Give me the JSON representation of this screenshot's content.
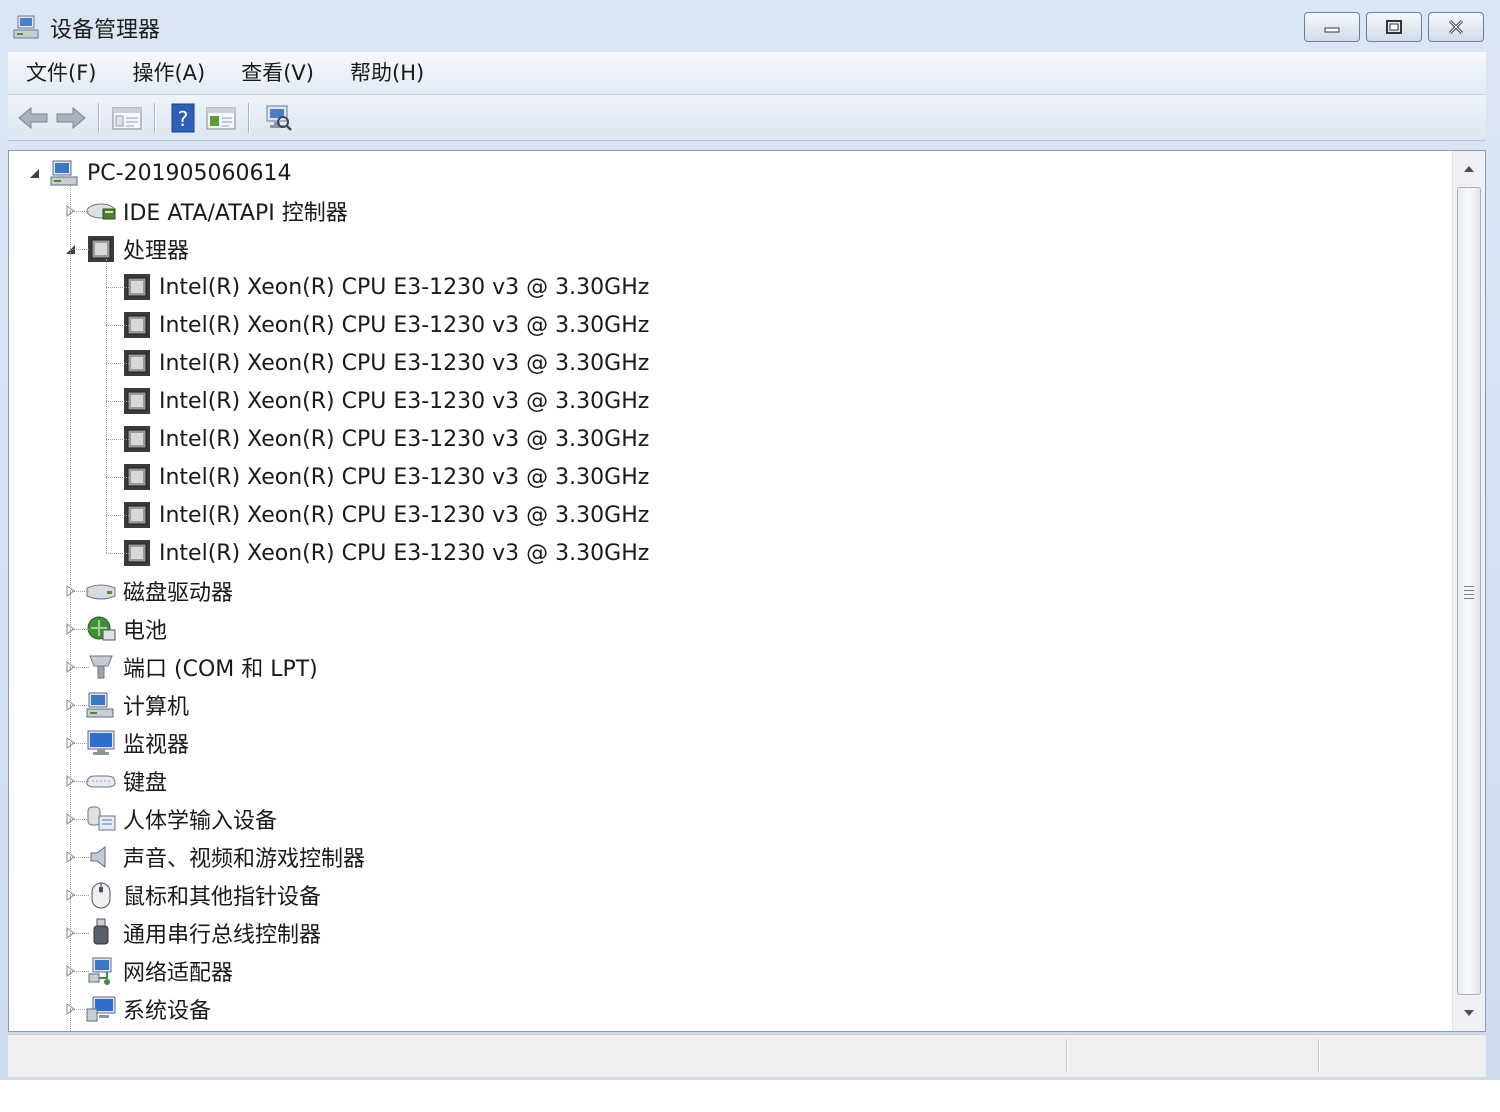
{
  "window": {
    "title": "设备管理器",
    "colors": {
      "frame": "#dbe6f4",
      "menubar": "#eef3f9",
      "pane": "#ffffff"
    }
  },
  "menu": {
    "items": [
      {
        "label": "文件(F)"
      },
      {
        "label": "操作(A)"
      },
      {
        "label": "查看(V)"
      },
      {
        "label": "帮助(H)"
      }
    ]
  },
  "toolbar": {
    "buttons": [
      "back-arrow-icon",
      "forward-arrow-icon",
      "console-tree-icon",
      "help-icon",
      "properties-icon",
      "scan-hardware-icon"
    ]
  },
  "tree": {
    "root": {
      "label": "PC-201905060614",
      "icon": "computer-icon",
      "expanded": true
    },
    "nodes": [
      {
        "label": "IDE ATA/ATAPI 控制器",
        "icon": "ide-controller-icon",
        "expanded": false
      },
      {
        "label": "处理器",
        "icon": "processor-icon",
        "expanded": true,
        "children": [
          "Intel(R) Xeon(R) CPU E3-1230 v3 @ 3.30GHz",
          "Intel(R) Xeon(R) CPU E3-1230 v3 @ 3.30GHz",
          "Intel(R) Xeon(R) CPU E3-1230 v3 @ 3.30GHz",
          "Intel(R) Xeon(R) CPU E3-1230 v3 @ 3.30GHz",
          "Intel(R) Xeon(R) CPU E3-1230 v3 @ 3.30GHz",
          "Intel(R) Xeon(R) CPU E3-1230 v3 @ 3.30GHz",
          "Intel(R) Xeon(R) CPU E3-1230 v3 @ 3.30GHz",
          "Intel(R) Xeon(R) CPU E3-1230 v3 @ 3.30GHz"
        ]
      },
      {
        "label": "磁盘驱动器",
        "icon": "disk-drive-icon",
        "expanded": false
      },
      {
        "label": "电池",
        "icon": "battery-icon",
        "expanded": false
      },
      {
        "label": "端口 (COM 和 LPT)",
        "icon": "port-icon",
        "expanded": false
      },
      {
        "label": "计算机",
        "icon": "computer-icon",
        "expanded": false
      },
      {
        "label": "监视器",
        "icon": "monitor-icon",
        "expanded": false
      },
      {
        "label": "键盘",
        "icon": "keyboard-icon",
        "expanded": false
      },
      {
        "label": "人体学输入设备",
        "icon": "hid-icon",
        "expanded": false
      },
      {
        "label": "声音、视频和游戏控制器",
        "icon": "speaker-icon",
        "expanded": false
      },
      {
        "label": "鼠标和其他指针设备",
        "icon": "mouse-icon",
        "expanded": false
      },
      {
        "label": "通用串行总线控制器",
        "icon": "usb-icon",
        "expanded": false
      },
      {
        "label": "网络适配器",
        "icon": "network-adapter-icon",
        "expanded": false
      },
      {
        "label": "系统设备",
        "icon": "system-device-icon",
        "expanded": false
      }
    ]
  }
}
